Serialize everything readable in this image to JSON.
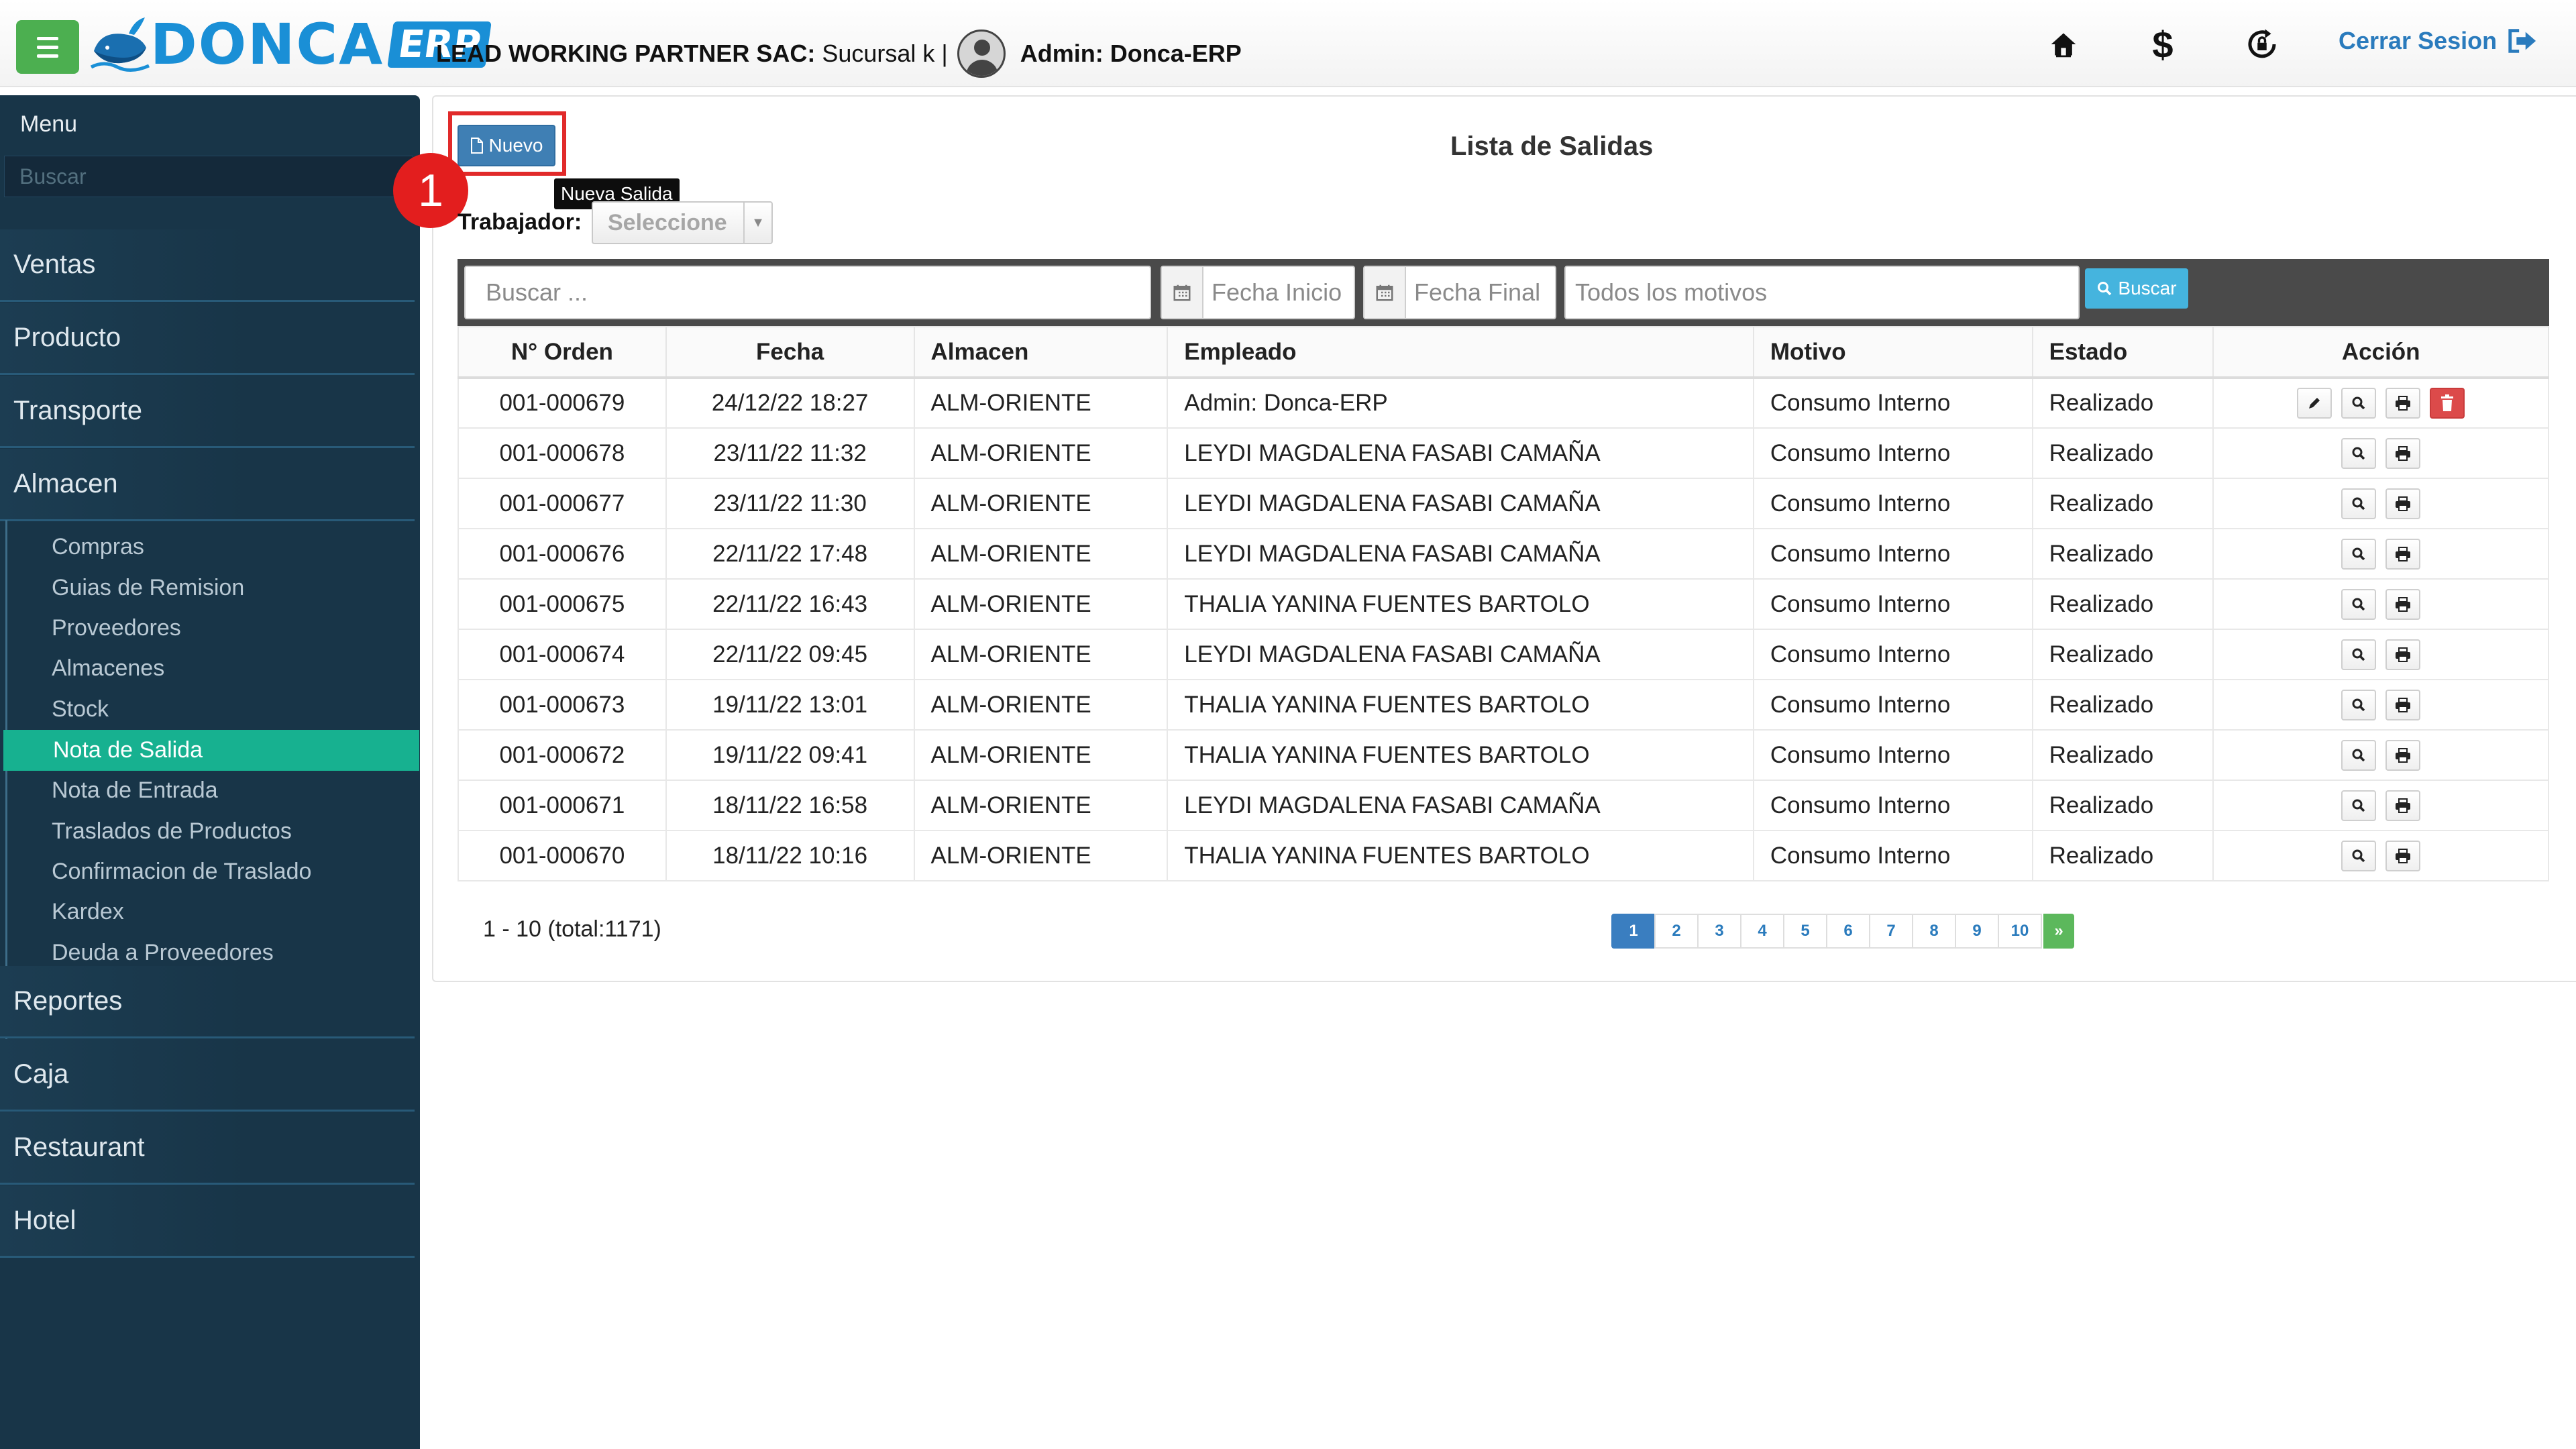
{
  "header": {
    "logo_text": "DONCA",
    "logo_badge": "ERP",
    "company_name": "LEAD WORKING PARTNER SAC:",
    "branch": "Sucursal k |",
    "user": "Admin: Donca-ERP",
    "logout_label": "Cerrar Sesion",
    "icons": [
      "home-icon",
      "dollar-icon",
      "refresh-lock-icon",
      "sign-out-icon"
    ]
  },
  "sidebar": {
    "title": "Menu",
    "search_placeholder": "Buscar",
    "items": [
      "Ventas",
      "Producto",
      "Transporte",
      "Almacen",
      "Reportes",
      "Caja",
      "Restaurant",
      "Hotel"
    ],
    "almacen_subitems": [
      "Compras",
      "Guias de Remision",
      "Proveedores",
      "Almacenes",
      "Stock",
      "Nota de Salida",
      "Nota de Entrada",
      "Traslados de Productos",
      "Confirmacion de Traslado",
      "Kardex",
      "Deuda a Proveedores"
    ],
    "active_subitem": "Nota de Salida"
  },
  "toolbar": {
    "new_label": "Nuevo",
    "tooltip": "Nueva Salida",
    "step_number": "1"
  },
  "main": {
    "title": "Lista de Salidas",
    "worker_label": "Trabajador:",
    "worker_value": "Seleccione"
  },
  "filters": {
    "search_placeholder": "Buscar ...",
    "date_start_placeholder": "Fecha Inicio",
    "date_end_placeholder": "Fecha Final",
    "reason_placeholder": "Todos los motivos",
    "search_button": "Buscar"
  },
  "table": {
    "columns": [
      "N° Orden",
      "Fecha",
      "Almacen",
      "Empleado",
      "Motivo",
      "Estado",
      "Acción"
    ],
    "rows": [
      {
        "orden": "001-000679",
        "fecha": "24/12/22 18:27",
        "almacen": "ALM-ORIENTE",
        "empleado": "Admin: Donca-ERP",
        "motivo": "Consumo Interno",
        "estado": "Realizado"
      },
      {
        "orden": "001-000678",
        "fecha": "23/11/22 11:32",
        "almacen": "ALM-ORIENTE",
        "empleado": "LEYDI MAGDALENA FASABI CAMAÑA",
        "motivo": "Consumo Interno",
        "estado": "Realizado"
      },
      {
        "orden": "001-000677",
        "fecha": "23/11/22 11:30",
        "almacen": "ALM-ORIENTE",
        "empleado": "LEYDI MAGDALENA FASABI CAMAÑA",
        "motivo": "Consumo Interno",
        "estado": "Realizado"
      },
      {
        "orden": "001-000676",
        "fecha": "22/11/22 17:48",
        "almacen": "ALM-ORIENTE",
        "empleado": "LEYDI MAGDALENA FASABI CAMAÑA",
        "motivo": "Consumo Interno",
        "estado": "Realizado"
      },
      {
        "orden": "001-000675",
        "fecha": "22/11/22 16:43",
        "almacen": "ALM-ORIENTE",
        "empleado": "THALIA YANINA FUENTES BARTOLO",
        "motivo": "Consumo Interno",
        "estado": "Realizado"
      },
      {
        "orden": "001-000674",
        "fecha": "22/11/22 09:45",
        "almacen": "ALM-ORIENTE",
        "empleado": "LEYDI MAGDALENA FASABI CAMAÑA",
        "motivo": "Consumo Interno",
        "estado": "Realizado"
      },
      {
        "orden": "001-000673",
        "fecha": "19/11/22 13:01",
        "almacen": "ALM-ORIENTE",
        "empleado": "THALIA YANINA FUENTES BARTOLO",
        "motivo": "Consumo Interno",
        "estado": "Realizado"
      },
      {
        "orden": "001-000672",
        "fecha": "19/11/22 09:41",
        "almacen": "ALM-ORIENTE",
        "empleado": "THALIA YANINA FUENTES BARTOLO",
        "motivo": "Consumo Interno",
        "estado": "Realizado"
      },
      {
        "orden": "001-000671",
        "fecha": "18/11/22 16:58",
        "almacen": "ALM-ORIENTE",
        "empleado": "LEYDI MAGDALENA FASABI CAMAÑA",
        "motivo": "Consumo Interno",
        "estado": "Realizado"
      },
      {
        "orden": "001-000670",
        "fecha": "18/11/22 10:16",
        "almacen": "ALM-ORIENTE",
        "empleado": "THALIA YANINA FUENTES BARTOLO",
        "motivo": "Consumo Interno",
        "estado": "Realizado"
      }
    ]
  },
  "pagination": {
    "summary": "1 - 10 (total:1171)",
    "pages": [
      "1",
      "2",
      "3",
      "4",
      "5",
      "6",
      "7",
      "8",
      "9",
      "10"
    ],
    "current": "1",
    "next_label": "»"
  },
  "colors": {
    "sidebar_bg": "#183548",
    "active_item": "#17b190",
    "primary_button": "#3f7fb4",
    "search_button": "#45b4de",
    "delete_button": "#dc4a4a",
    "highlight": "#e12a2a",
    "brand": "#1a8fd6"
  }
}
